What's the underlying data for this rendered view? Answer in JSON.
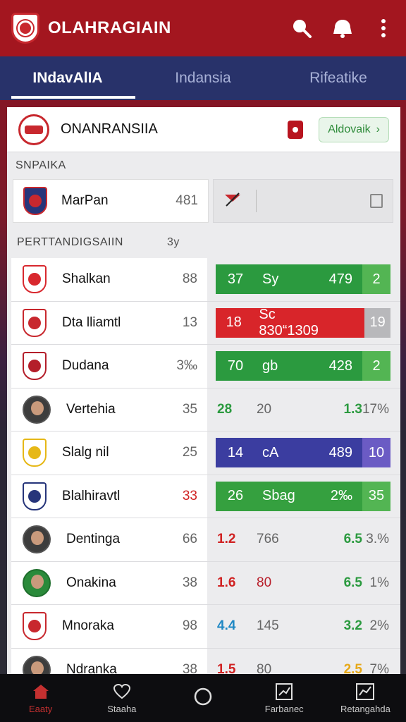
{
  "header": {
    "title": "OLAHRAGIAIN",
    "icons": [
      "search-icon",
      "notification-icon",
      "more-icon"
    ]
  },
  "tabs": [
    {
      "label": "INdavAlIA",
      "active": true
    },
    {
      "label": "Indansia",
      "active": false
    },
    {
      "label": "Rifeatike",
      "active": false
    }
  ],
  "card": {
    "title": "ONANRANSIIA",
    "action_label": "Aldovaik",
    "section1": "SNPAIKA",
    "featured": {
      "name": "MarPan",
      "value": "481"
    },
    "section2": "PERTTANDIGSAIIN",
    "section2_count": "3y"
  },
  "rows": [
    {
      "type": "crest",
      "name": "Shalkan",
      "value": "88",
      "value_red": false,
      "crest_color": "#d8282e",
      "bar": {
        "color": "#2b9a3f",
        "end_color": "#53b553",
        "a": "37",
        "b": "Sy",
        "c": "479",
        "d": "2"
      }
    },
    {
      "type": "crest",
      "name": "Dta lliamtl",
      "value": "13",
      "value_red": false,
      "crest_color": "#c8282e",
      "bar": {
        "color": "#d8252a",
        "end_color": "#b8b8bb",
        "a": "18",
        "b": "Sc 830“1309",
        "c": "",
        "d": "19"
      }
    },
    {
      "type": "crest",
      "name": "Dudana",
      "value": "3‰",
      "value_red": false,
      "crest_color": "#b41e2a",
      "bar": {
        "color": "#2b9a3f",
        "end_color": "#53b553",
        "a": "70",
        "b": "gb",
        "c": "428",
        "d": "2"
      }
    },
    {
      "type": "avatar",
      "name": "Vertehia",
      "value": "35",
      "value_red": false,
      "stats": {
        "a": "28",
        "a_color": "#2b9a3f",
        "b": "20",
        "c": "1.3",
        "c_color": "#2b9a3f",
        "d": "17%"
      }
    },
    {
      "type": "crest",
      "name": "Slalg nil",
      "value": "25",
      "value_red": false,
      "crest_color": "#e6b817",
      "bar": {
        "color": "#3b3da0",
        "end_color": "#6b5bc4",
        "a": "14",
        "b": "cA",
        "c": "489",
        "d": "10"
      }
    },
    {
      "type": "crest",
      "name": "Blalhiravtl",
      "value": "33",
      "value_red": true,
      "crest_color": "#27357a",
      "bar": {
        "color": "#35a03f",
        "end_color": "#53b553",
        "a": "26",
        "b": "Sbag",
        "c": "2‰",
        "d": "35"
      }
    },
    {
      "type": "avatar",
      "name": "Dentinga",
      "value": "66",
      "value_red": false,
      "stats": {
        "a": "1.2",
        "a_color": "#d02222",
        "b": "766",
        "c": "6.5",
        "c_color": "#2b9a3f",
        "d": "3.%"
      }
    },
    {
      "type": "avatar-green",
      "name": "Onakina",
      "value": "38",
      "value_red": false,
      "stats": {
        "a": "1.6",
        "a_color": "#d02222",
        "b": "80",
        "b_color": "#b81e2a",
        "c": "6.5",
        "c_color": "#2b9a3f",
        "d": "1%"
      }
    },
    {
      "type": "crest",
      "name": "Mnoraka",
      "value": "98",
      "value_red": false,
      "crest_color": "#c8282e",
      "stats": {
        "a": "4.4",
        "a_color": "#1f88c4",
        "b": "145",
        "c": "3.2",
        "c_color": "#2b9a3f",
        "d": "2%"
      }
    },
    {
      "type": "avatar",
      "name": "Ndranka",
      "value": "38",
      "value_red": false,
      "stats": {
        "a": "1.5",
        "a_color": "#d02222",
        "b": "80",
        "c": "2.5",
        "c_color": "#e6a817",
        "d": "7%"
      }
    }
  ],
  "bottom_nav": [
    {
      "label": "Eaaty",
      "icon": "home-icon",
      "active": true
    },
    {
      "label": "Staaha",
      "icon": "heart-icon",
      "active": false
    },
    {
      "label": "",
      "icon": "circle-icon",
      "active": false
    },
    {
      "label": "Farbanec",
      "icon": "chart-icon",
      "active": false
    },
    {
      "label": "Retangahda",
      "icon": "stats-icon",
      "active": false
    }
  ],
  "colors": {
    "header_bg": "#a3161f",
    "tabs_bg": "#28326a",
    "accent_red": "#c8282e",
    "green": "#2b9a3f"
  }
}
